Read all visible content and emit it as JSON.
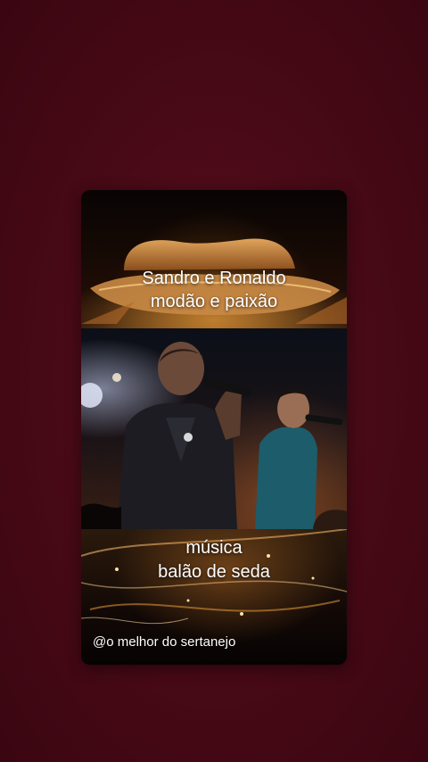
{
  "post": {
    "headline_line1": "Sandro e Ronaldo",
    "headline_line2": "modão e paixão",
    "song_label": "música",
    "song_title": "balão de seda",
    "credit": "@o melhor do sertanejo"
  },
  "colors": {
    "background": "#4a0a17",
    "text": "#ffffff",
    "accent_gold": "#d89a4a"
  }
}
